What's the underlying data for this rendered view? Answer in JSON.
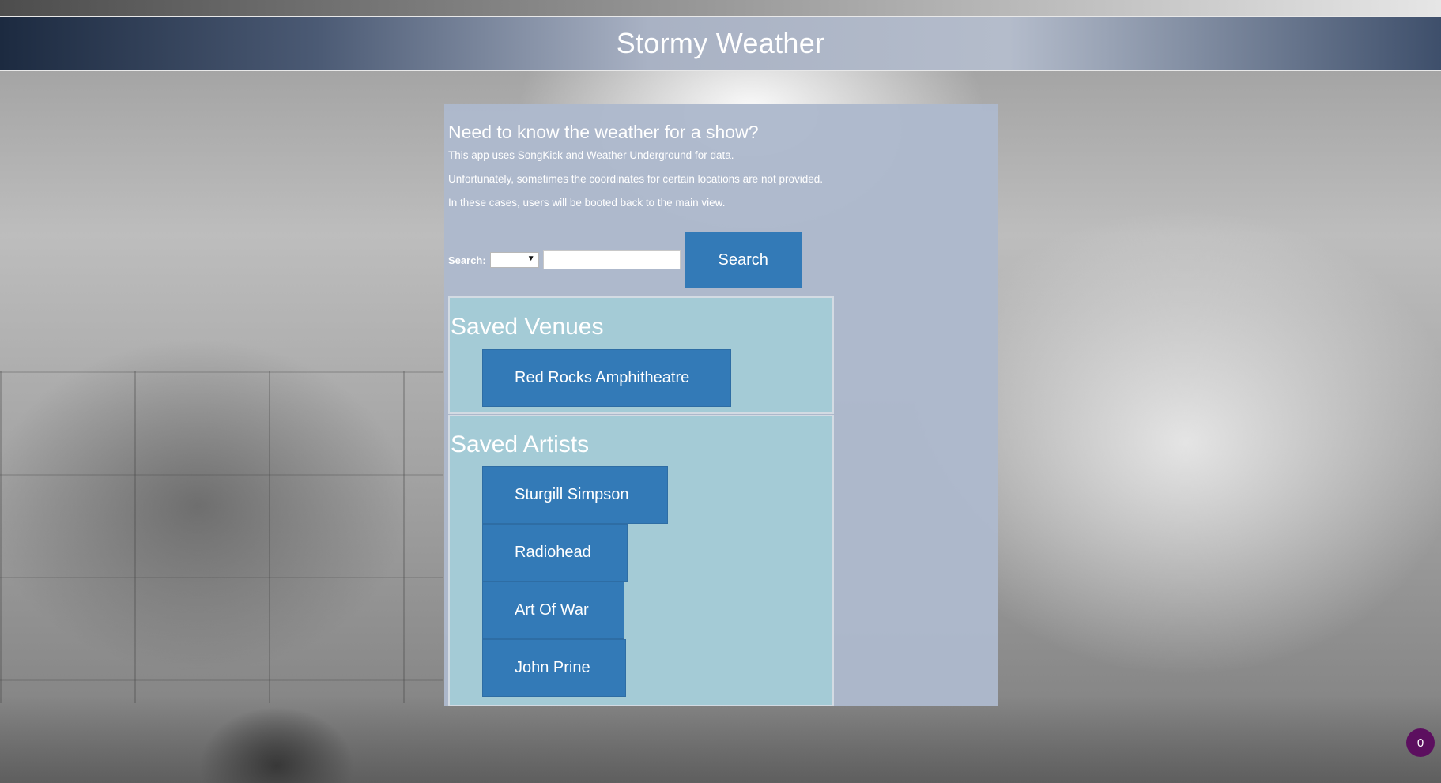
{
  "header": {
    "title": "Stormy Weather"
  },
  "intro": {
    "heading": "Need to know the weather for a show?",
    "lines": [
      "This app uses SongKick and Weather Underground for data.",
      "Unfortunately, sometimes the coordinates for certain locations are not provided.",
      "In these cases, users will be booted back to the main view."
    ]
  },
  "search": {
    "label": "Search:",
    "select_value": "",
    "input_value": "",
    "button_label": "Search"
  },
  "saved_venues": {
    "title": "Saved Venues",
    "items": [
      "Red Rocks Amphitheatre"
    ]
  },
  "saved_artists": {
    "title": "Saved Artists",
    "items": [
      "Sturgill Simpson",
      "Radiohead",
      "Art Of War",
      "John Prine"
    ]
  },
  "notification_badge": {
    "count": "0",
    "color": "#5c0f5f"
  },
  "colors": {
    "button": "#337ab7",
    "panel": "#adb9cc",
    "saved_box": "#a3cbd6"
  }
}
